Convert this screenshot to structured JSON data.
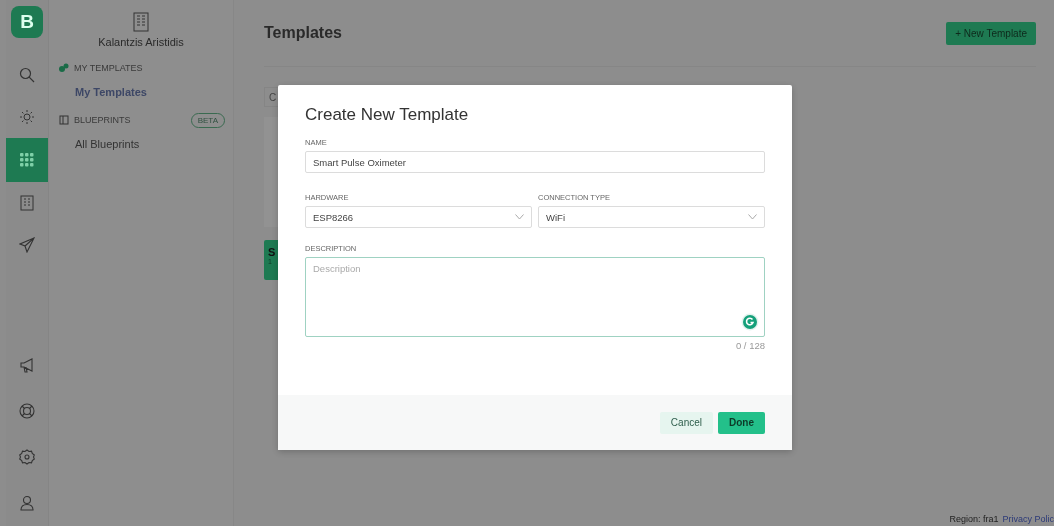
{
  "rail": {
    "logo": "B",
    "items": [
      {
        "kind": "search",
        "selected": false
      },
      {
        "kind": "sun",
        "selected": false
      },
      {
        "kind": "grid",
        "selected": true
      },
      {
        "kind": "building",
        "selected": false
      },
      {
        "kind": "send",
        "selected": false
      },
      {
        "kind": "megaphone",
        "selected": false
      },
      {
        "kind": "lifebuoy",
        "selected": false
      },
      {
        "kind": "settings",
        "selected": false
      },
      {
        "kind": "user",
        "selected": false
      }
    ]
  },
  "sidebar": {
    "org_name": "Kalantzis Aristidis",
    "sections": [
      {
        "kind": "templates",
        "title": "MY TEMPLATES",
        "items": [
          {
            "label": "My Templates",
            "selected": true
          }
        ]
      },
      {
        "kind": "blueprints",
        "title": "BLUEPRINTS",
        "badge": "BETA",
        "items": [
          {
            "label": "All Blueprints",
            "selected": false
          }
        ]
      }
    ]
  },
  "page": {
    "title": "Templates",
    "new_button": "+ New Template",
    "search": {
      "placeholder": "C"
    },
    "card": {
      "title": "S",
      "subtitle": "1"
    }
  },
  "modal": {
    "title": "Create New Template",
    "fields": [
      {
        "kind": "text",
        "label": "NAME",
        "value": "Smart Pulse Oximeter"
      },
      {
        "kind": "select",
        "label": "HARDWARE",
        "value": "ESP8266"
      },
      {
        "kind": "select",
        "label": "CONNECTION TYPE",
        "value": "WiFi"
      },
      {
        "kind": "textarea",
        "label": "DESCRIPTION",
        "placeholder": "Description",
        "counter": "0 / 128"
      }
    ],
    "buttons": [
      {
        "kind": "secondary",
        "label": "Cancel"
      },
      {
        "kind": "primary",
        "label": "Done"
      }
    ]
  },
  "footer": {
    "region": "Region: fra1",
    "link": "Privacy Polic"
  }
}
